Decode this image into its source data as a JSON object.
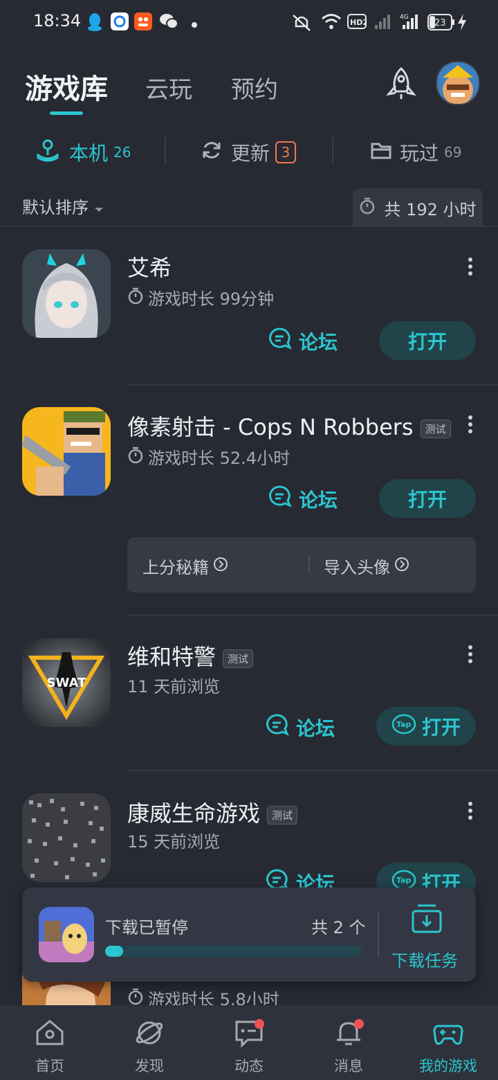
{
  "status_bar": {
    "time": "18:34",
    "left_icons": [
      "qq-icon",
      "app-icon",
      "taobao-icon",
      "wechat-icon",
      "dot-icon"
    ],
    "right_icons": [
      "mute-vibrate-icon",
      "wifi-icon",
      "hd-icon",
      "signal-icon",
      "signal-4g-icon",
      "battery-icon",
      "charging-icon"
    ],
    "hd_label": "HD2",
    "network_label": "4G",
    "battery": "23"
  },
  "header": {
    "tabs": [
      {
        "label": "游戏库",
        "active": true
      },
      {
        "label": "云玩",
        "active": false
      },
      {
        "label": "预约",
        "active": false
      }
    ],
    "icons": [
      "rocket-icon",
      "avatar"
    ]
  },
  "subtabs": [
    {
      "label": "本机",
      "count": "26",
      "icon": "joystick-icon",
      "active": true
    },
    {
      "label": "更新",
      "count": "3",
      "icon": "refresh-icon",
      "active": false
    },
    {
      "label": "玩过",
      "count": "69",
      "icon": "folder-icon",
      "active": false
    }
  ],
  "sort": {
    "label": "默认排序"
  },
  "total_time": "共 192 小时",
  "games": [
    {
      "title": "艾希",
      "tag": "",
      "meta": "游戏时长 99分钟",
      "meta_has_timer": true,
      "forum": "论坛",
      "open": "打开",
      "open_tap_icon": false
    },
    {
      "title": "像素射击 - Cops N Robbers",
      "tag": "测试",
      "meta": "游戏时长 52.4小时",
      "meta_has_timer": true,
      "forum": "论坛",
      "open": "打开",
      "open_tap_icon": false
    },
    {
      "title": "维和特警",
      "tag": "测试",
      "meta": "11 天前浏览",
      "meta_has_timer": false,
      "forum": "论坛",
      "open": "打开",
      "open_tap_icon": true,
      "icon_text": "SWAT"
    },
    {
      "title": "康威生命游戏",
      "tag": "测试",
      "meta": "15 天前浏览",
      "meta_has_timer": false,
      "forum": "论坛",
      "open": "打开",
      "open_tap_icon": true
    },
    {
      "title": "",
      "meta": "游戏时长 5.8小时",
      "meta_has_timer": true
    }
  ],
  "tips_panel": {
    "items": [
      "上分秘籍",
      "导入头像"
    ]
  },
  "download": {
    "status": "下载已暂停",
    "count": "共 2 个",
    "progress": 0.07,
    "button": "下载任务"
  },
  "bottom_nav": [
    {
      "label": "首页",
      "icon": "home-icon",
      "active": false,
      "dot": false
    },
    {
      "label": "发现",
      "icon": "planet-icon",
      "active": false,
      "dot": false
    },
    {
      "label": "动态",
      "icon": "chat-icon",
      "active": false,
      "dot": true
    },
    {
      "label": "消息",
      "icon": "bell-icon",
      "active": false,
      "dot": true
    },
    {
      "label": "我的游戏",
      "icon": "gamepad-icon",
      "active": true,
      "dot": false
    }
  ],
  "colors": {
    "accent": "#2bc6cf",
    "badge": "#ef7a52",
    "background": "#272a33",
    "dot": "#f05252"
  }
}
